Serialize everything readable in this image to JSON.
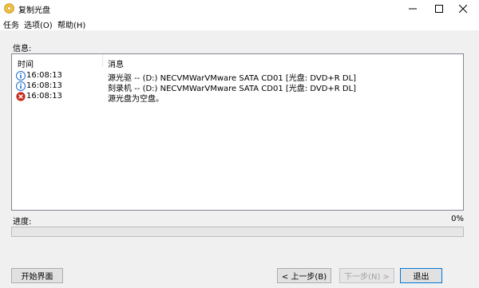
{
  "window": {
    "title": "复制光盘",
    "icon": "disc-icon",
    "controls": {
      "minimize": "minimize-icon",
      "maximize": "maximize-icon",
      "close": "close-icon"
    }
  },
  "menu": {
    "items": [
      {
        "label": "任务"
      },
      {
        "label": "选项(O)"
      },
      {
        "label": "帮助(H)"
      }
    ]
  },
  "info": {
    "label": "信息:",
    "columns": {
      "time": "时间",
      "message": "消息"
    },
    "rows": [
      {
        "icon": "info-icon",
        "time": "16:08:13",
        "message": "源光驱 -- (D:) NECVMWarVMware SATA CD01 [光盘:  DVD+R DL]"
      },
      {
        "icon": "info-icon",
        "time": "16:08:13",
        "message": "刻录机 -- (D:) NECVMWarVMware SATA CD01 [光盘:  DVD+R DL]"
      },
      {
        "icon": "error-icon",
        "time": "16:08:13",
        "message": "源光盘为空盘。"
      }
    ]
  },
  "progress": {
    "label": "进度:",
    "percent_text": "0%",
    "value": 0
  },
  "buttons": {
    "start": "开始界面",
    "prev": "< 上一步(B)",
    "next": "下一步(N) >",
    "exit": "退出"
  },
  "colors": {
    "client_bg": "#f0f0f0",
    "info_blue": "#1e6fd0",
    "error_red": "#c42b1c",
    "progress_fill": "#06b025"
  }
}
